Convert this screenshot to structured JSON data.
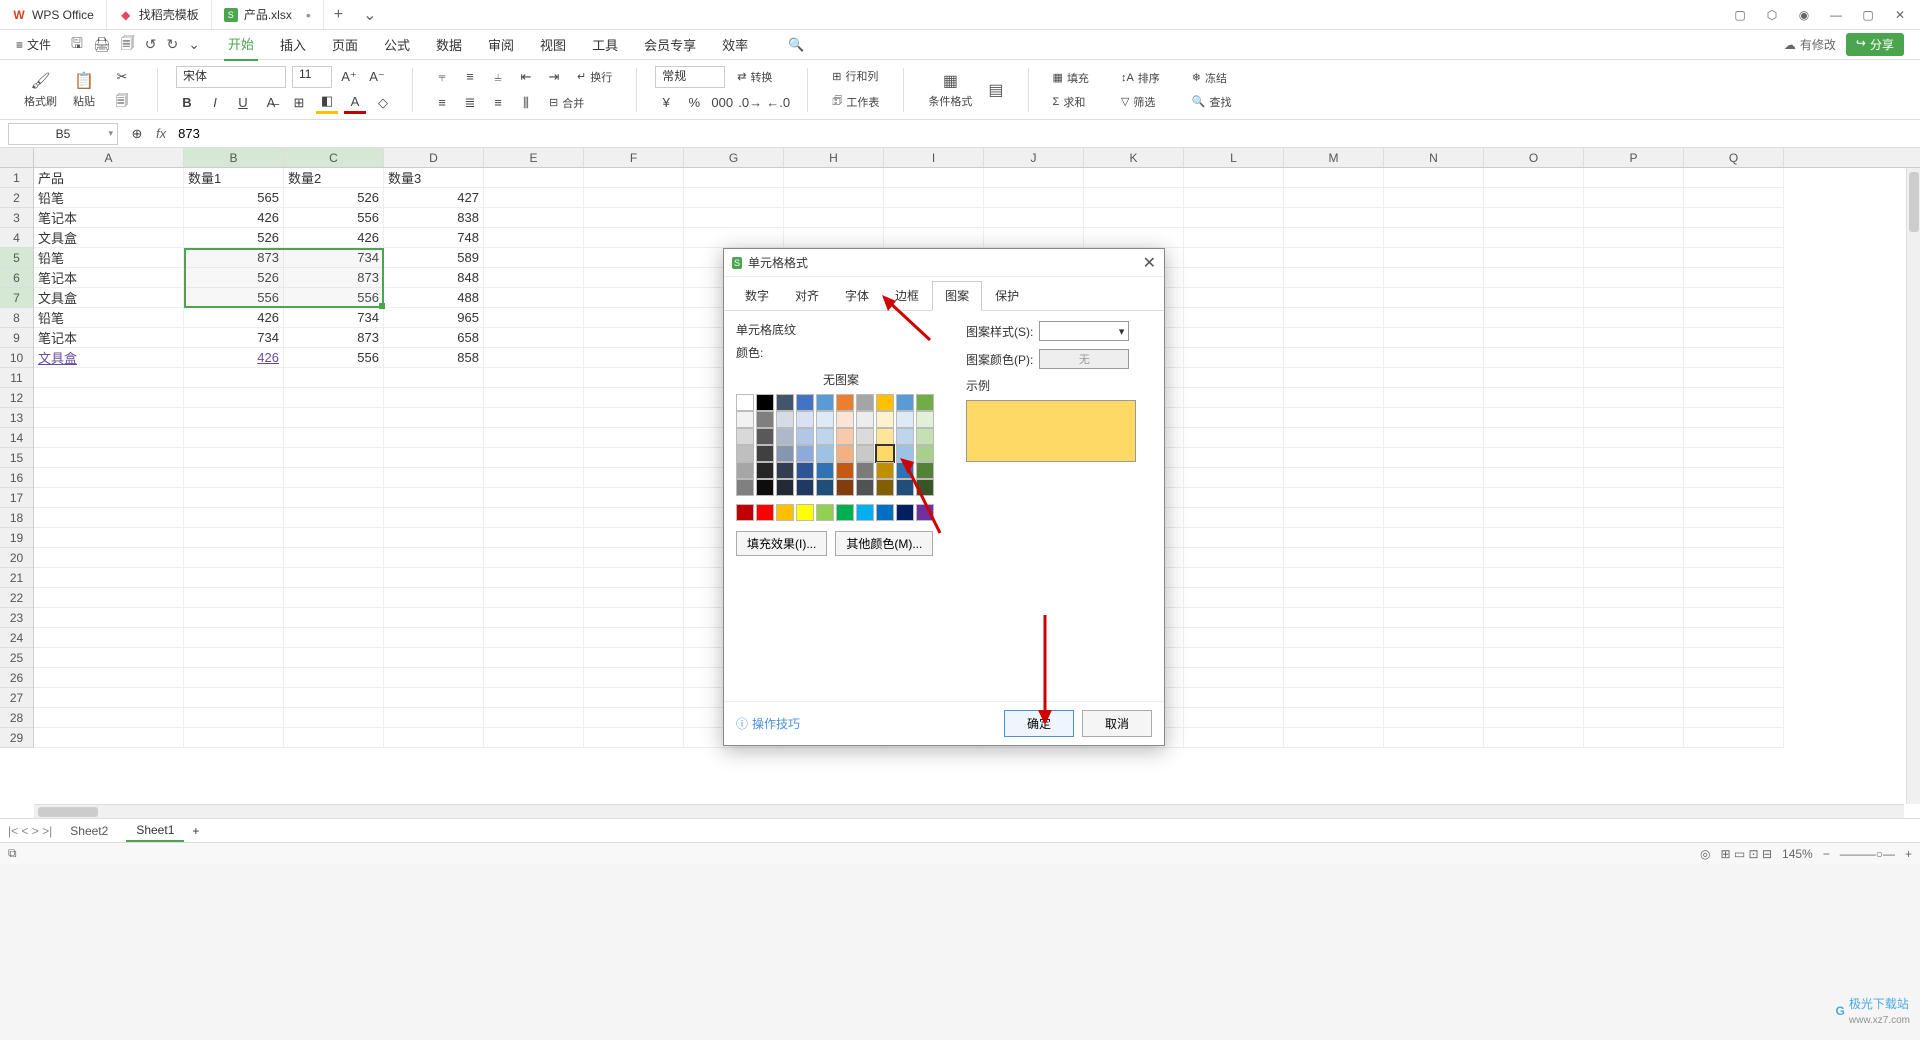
{
  "titlebar": {
    "tabs": [
      {
        "icon": "W",
        "label": "WPS Office"
      },
      {
        "icon": "D",
        "label": "找稻壳模板"
      },
      {
        "icon": "S",
        "label": "产品.xlsx"
      }
    ]
  },
  "menubar": {
    "file": "文件",
    "tabs": [
      "开始",
      "插入",
      "页面",
      "公式",
      "数据",
      "审阅",
      "视图",
      "工具",
      "会员专享",
      "效率"
    ],
    "unsaved": "有修改",
    "share": "分享"
  },
  "ribbon": {
    "format_painter": "格式刷",
    "paste": "粘贴",
    "font_name": "宋体",
    "font_size": "11",
    "wrap": "换行",
    "merge": "合并",
    "number_fmt": "常规",
    "convert": "转换",
    "rowcol": "行和列",
    "worksheet": "工作表",
    "cond_fmt": "条件格式",
    "fill": "填充",
    "sort": "排序",
    "freeze": "冻结",
    "sum": "求和",
    "filter": "筛选",
    "find": "查找"
  },
  "fxbar": {
    "name": "B5",
    "formula": "873"
  },
  "columns": [
    "A",
    "B",
    "C",
    "D",
    "E",
    "F",
    "G",
    "H",
    "I",
    "J",
    "K",
    "L",
    "M",
    "N",
    "O",
    "P",
    "Q"
  ],
  "colwidths": {
    "A": 150,
    "default": 100
  },
  "rows": 29,
  "data": [
    [
      "产品",
      "数量1",
      "数量2",
      "数量3"
    ],
    [
      "铅笔",
      "565",
      "526",
      "427"
    ],
    [
      "笔记本",
      "426",
      "556",
      "838"
    ],
    [
      "文具盒",
      "526",
      "426",
      "748"
    ],
    [
      "铅笔",
      "873",
      "734",
      "589"
    ],
    [
      "笔记本",
      "526",
      "873",
      "848"
    ],
    [
      "文具盒",
      "556",
      "556",
      "488"
    ],
    [
      "铅笔",
      "426",
      "734",
      "965"
    ],
    [
      "笔记本",
      "734",
      "873",
      "658"
    ],
    [
      "文具盒",
      "426",
      "556",
      "858"
    ]
  ],
  "sheets": [
    "Sheet2",
    "Sheet1"
  ],
  "status": {
    "zoom": "145%"
  },
  "dialog": {
    "title": "单元格格式",
    "tabs": [
      "数字",
      "对齐",
      "字体",
      "边框",
      "图案",
      "保护"
    ],
    "active_tab": 4,
    "shading_label": "单元格底纹",
    "color_label": "颜色:",
    "no_pattern": "无图案",
    "fill_effects": "填充效果(I)...",
    "more_colors": "其他颜色(M)...",
    "pattern_style": "图案样式(S):",
    "pattern_color": "图案颜色(P):",
    "pattern_color_value": "无",
    "sample": "示例",
    "tips": "操作技巧",
    "ok": "确定",
    "cancel": "取消"
  },
  "palette": {
    "row1": [
      "#ffffff",
      "#000000",
      "#44546a",
      "#4472c4",
      "#5b9bd5",
      "#ed7d31",
      "#a5a5a5",
      "#ffc000",
      "#5b9bd5",
      "#70ad47"
    ],
    "light1": [
      "#f2f2f2",
      "#7f7f7f",
      "#d6dce4",
      "#d9e1f2",
      "#deeaf6",
      "#fbe4d5",
      "#ededed",
      "#fff2cc",
      "#deeaf6",
      "#e2efd9"
    ],
    "light2": [
      "#d9d9d9",
      "#595959",
      "#adb9ca",
      "#b4c6e7",
      "#bdd6ee",
      "#f7caac",
      "#dbdbdb",
      "#ffe598",
      "#bdd6ee",
      "#c5e0b3"
    ],
    "light3": [
      "#bfbfbf",
      "#404040",
      "#8496b0",
      "#8eaadb",
      "#9cc2e5",
      "#f4b083",
      "#c9c9c9",
      "#ffd966",
      "#9cc2e5",
      "#a8d08d"
    ],
    "dark1": [
      "#a6a6a6",
      "#262626",
      "#323e4f",
      "#2f5496",
      "#2e74b5",
      "#c45911",
      "#7b7b7b",
      "#bf8f00",
      "#2e74b5",
      "#538135"
    ],
    "dark2": [
      "#808080",
      "#0d0d0d",
      "#222a35",
      "#1f3864",
      "#1f4e78",
      "#833c0b",
      "#525252",
      "#806000",
      "#1f4e78",
      "#385623"
    ],
    "standard": [
      "#c00000",
      "#ff0000",
      "#ffc000",
      "#ffff00",
      "#92d050",
      "#00b050",
      "#00b0f0",
      "#0070c0",
      "#002060",
      "#7030a0"
    ]
  },
  "watermark": {
    "name": "极光下载站",
    "url": "www.xz7.com"
  }
}
